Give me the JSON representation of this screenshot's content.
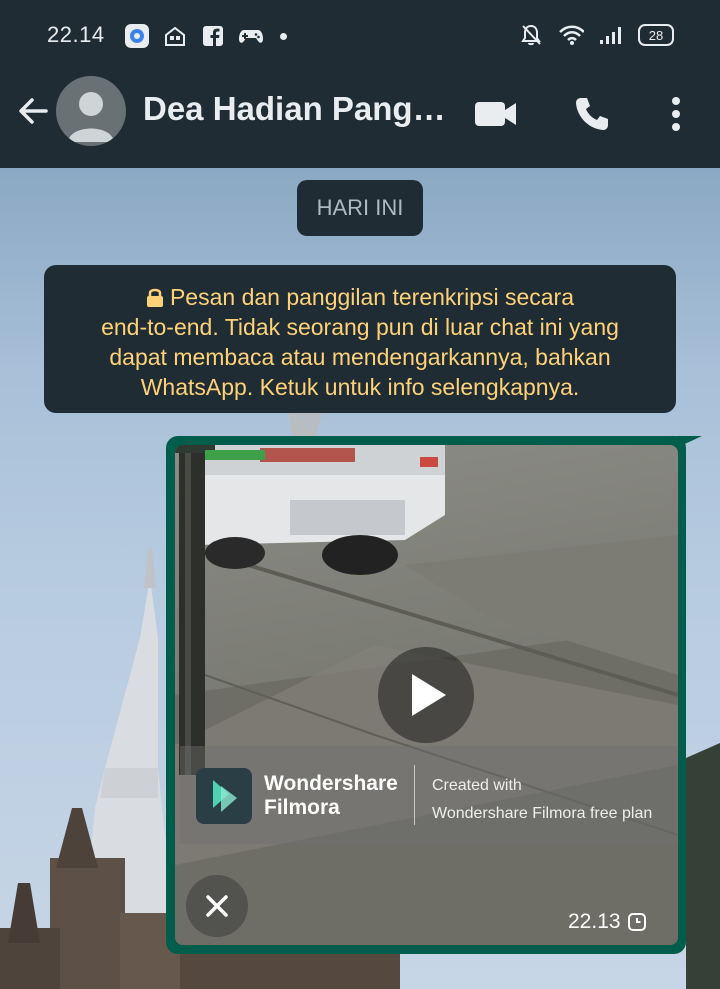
{
  "status_bar": {
    "time": "22.14",
    "battery": "28",
    "icons_left": [
      "app-icon",
      "home-icon",
      "facebook-icon",
      "gamepad-icon"
    ],
    "icons_right": [
      "mute-notifications-icon",
      "wifi-icon",
      "signal-icon",
      "battery-icon"
    ]
  },
  "header": {
    "contact_name": "Dea Hadian Pang…",
    "actions": [
      "video-call-icon",
      "voice-call-icon",
      "more-options-icon"
    ]
  },
  "chat": {
    "date_chip": "HARI INI",
    "encryption_notice": {
      "lines": [
        "Pesan dan panggilan terenkripsi secara",
        "end-to-end. Tidak seorang pun di luar chat ini yang",
        "dapat membaca atau mendengarkannya, bahkan",
        "WhatsApp. Ketuk untuk info selengkapnya."
      ],
      "icon": "lock-icon"
    },
    "video_message": {
      "watermark_brand_line1": "Wondershare",
      "watermark_brand_line2": "Filmora",
      "watermark_note_line1": "Created with",
      "watermark_note_line2": "Wondershare Filmora free plan",
      "time": "22.13",
      "status_icon": "pending-clock-icon"
    }
  },
  "colors": {
    "bar_bg": "#1f2c33",
    "bubble_out": "#005c4b",
    "notice_text": "#ffd279"
  }
}
